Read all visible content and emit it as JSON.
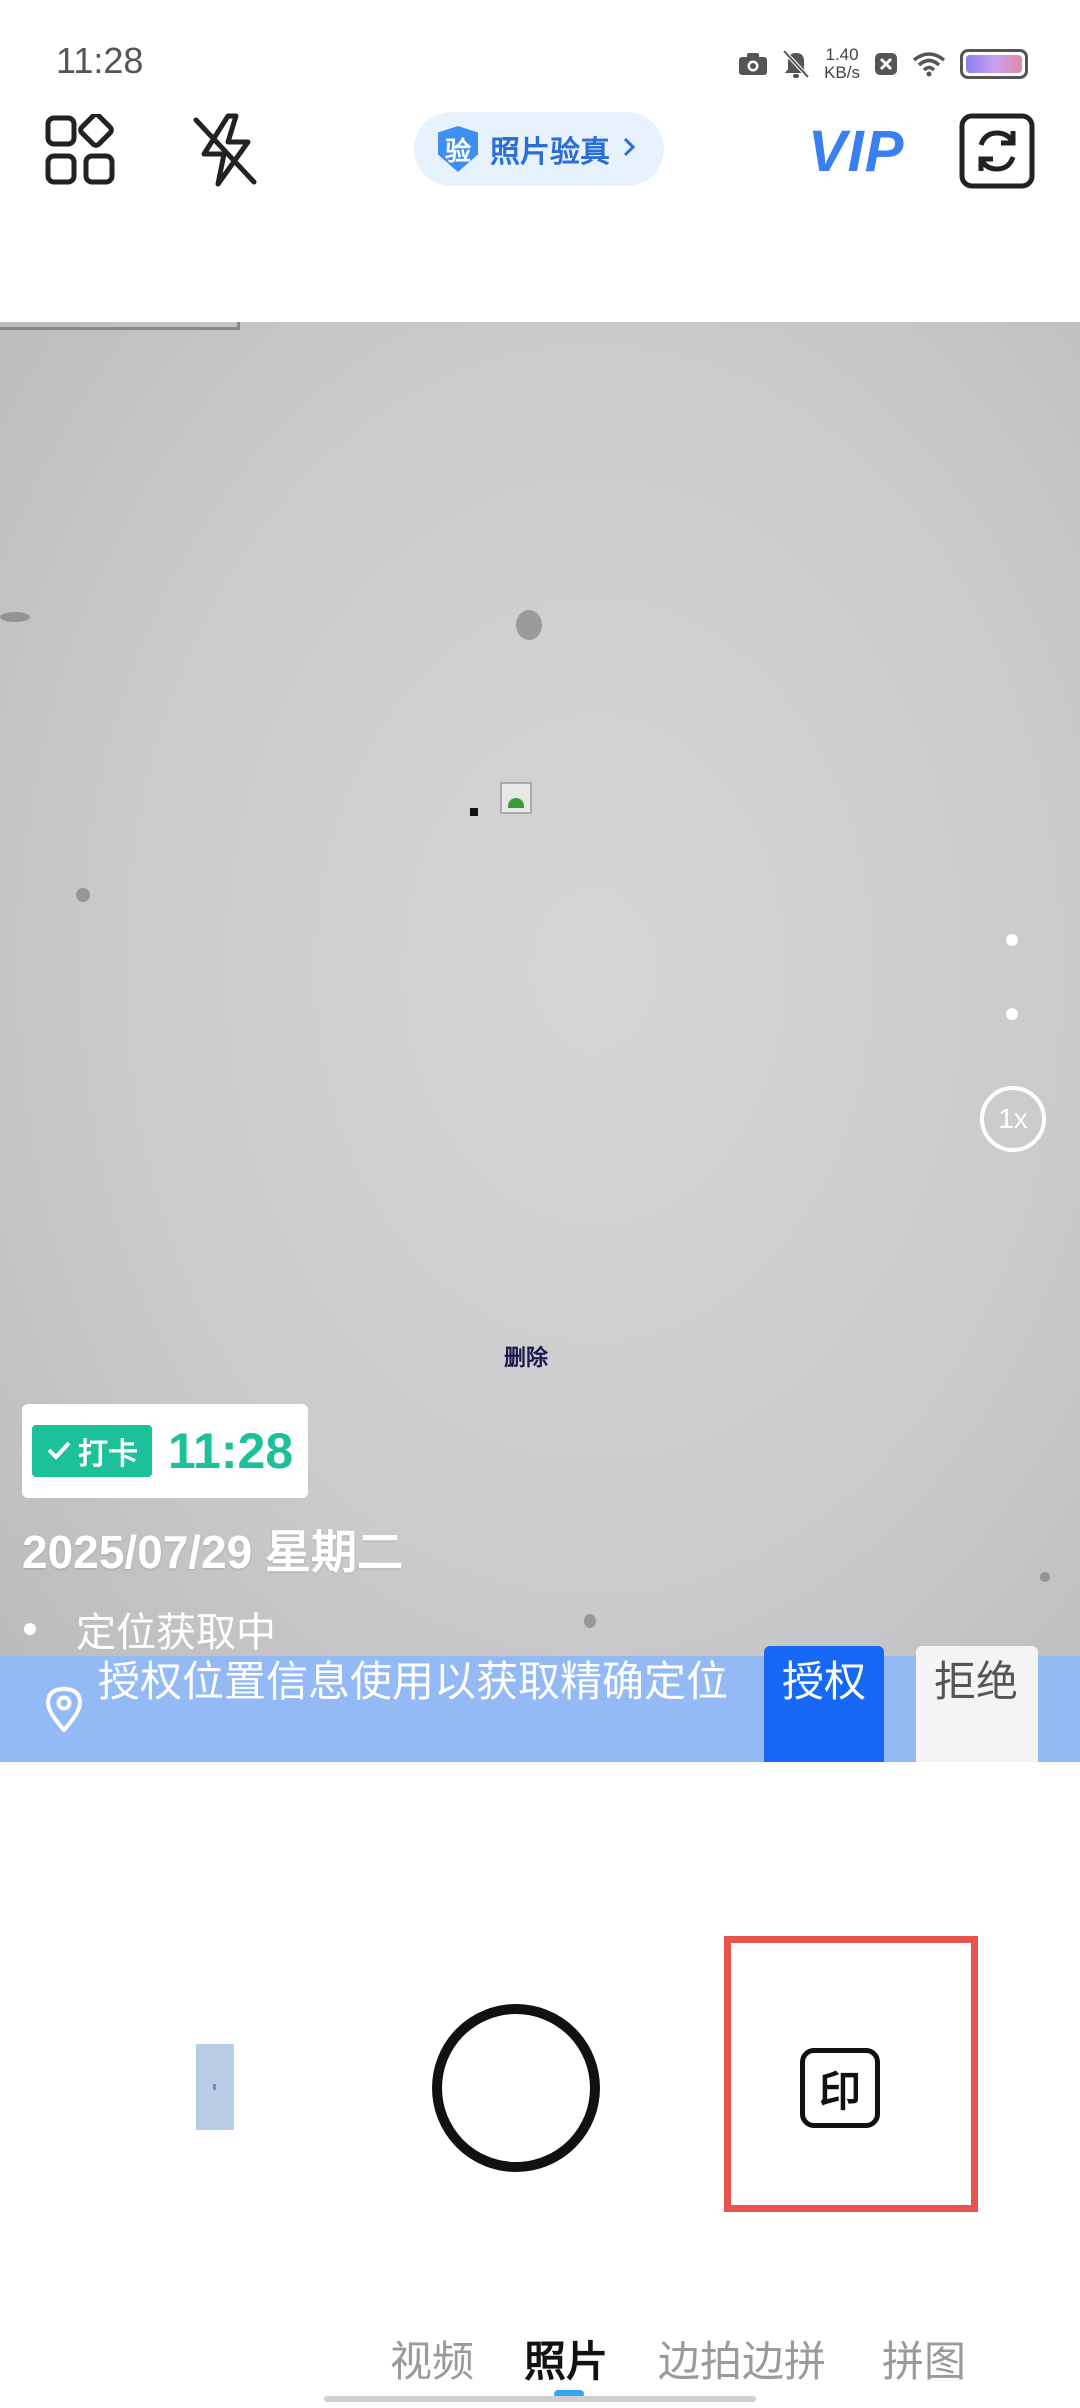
{
  "status_bar": {
    "time": "11:28",
    "net_speed_value": "1.40",
    "net_speed_unit": "KB/s",
    "icons": [
      "camera-icon",
      "mute-icon",
      "net-speed",
      "close-box-icon",
      "wifi-icon",
      "battery-icon"
    ]
  },
  "toolbar": {
    "verify_badge": "验",
    "verify_label": "照片验真",
    "vip_label": "VIP",
    "icons": [
      "grid-apps-icon",
      "flash-off-icon",
      "camera-switch-icon"
    ]
  },
  "preview": {
    "delete_label": "删除",
    "zoom_label": "1x"
  },
  "watermark": {
    "tag_label": "打卡",
    "time": "11:28",
    "date": "2025/07/29 星期二",
    "location": "定位获取中"
  },
  "permission": {
    "message": "授权位置信息使用以获取精确定位",
    "allow_label": "授权",
    "deny_label": "拒绝"
  },
  "controls": {
    "stamp_label": "印"
  },
  "modes": {
    "items": [
      "视频",
      "照片",
      "边拍边拼",
      "拼图"
    ],
    "active": "照片"
  },
  "colors": {
    "accent_green": "#1cc19a",
    "accent_blue": "#1769f5",
    "banner_blue": "#93baf5",
    "vip_blue": "#3a7ff0",
    "highlight_red": "#e8534e"
  }
}
